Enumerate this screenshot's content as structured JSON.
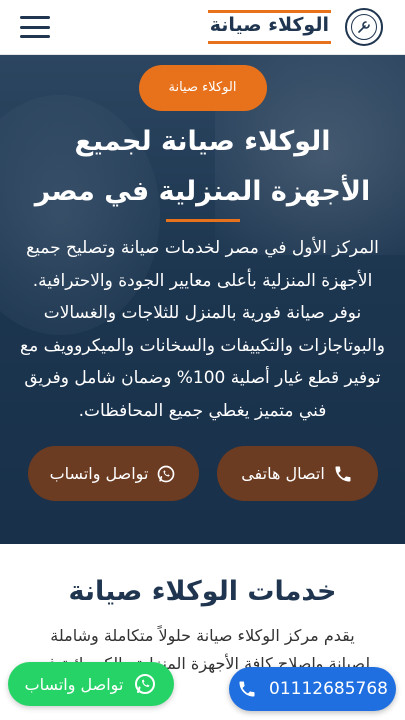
{
  "header": {
    "brand_name": "الوكلاء صيانة",
    "logo_icon": "logo-badge-icon",
    "menu_icon": "hamburger-menu-icon"
  },
  "hero": {
    "pill_label": "الوكلاء صيانة",
    "title_line1": "الوكلاء صيانة لجميع",
    "title_line2": "الأجهزة المنزلية في مصر",
    "description": "المركز الأول في مصر لخدمات صيانة وتصليح جميع الأجهزة المنزلية بأعلى معايير الجودة والاحترافية. نوفر صيانة فورية بالمنزل للثلاجات والغسالات والبوتاجازات والتكييفات والسخانات والميكروويف مع توفير قطع غيار أصلية 100% وضمان شامل وفريق فني متميز يغطي جميع المحافظات.",
    "call_button": "اتصال هاتفى",
    "whatsapp_button": "تواصل واتساب"
  },
  "services": {
    "title": "خدمات الوكلاء صيانة",
    "description": "يقدم مركز الوكلاء صيانة حلولاً متكاملة وشاملة لصيانة وإصلاح كافة الأجهزة المنزلية والكهربائية في"
  },
  "floating": {
    "whatsapp_label": "تواصل واتساب",
    "phone_number": "01112685768"
  },
  "colors": {
    "accent": "#e8721c",
    "navy": "#1f3550",
    "whatsapp": "#25d366",
    "call_blue": "#1f6fe0",
    "hero_button": "#6b3b22"
  }
}
